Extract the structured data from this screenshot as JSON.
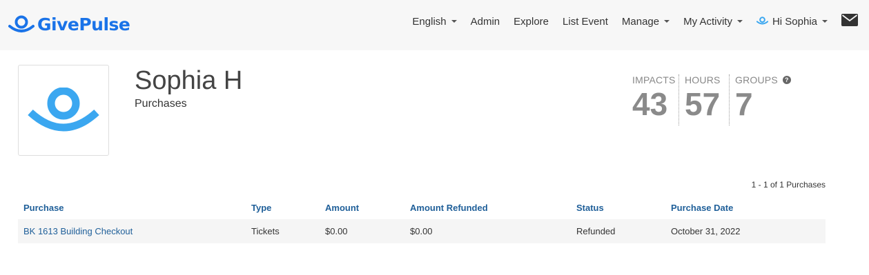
{
  "brand": {
    "name": "GivePulse",
    "color": "#1a73e8"
  },
  "nav": {
    "language": "English",
    "admin": "Admin",
    "explore": "Explore",
    "list_event": "List Event",
    "manage": "Manage",
    "my_activity": "My Activity",
    "user_greeting": "Hi Sophia",
    "icons": [
      "chevron-down-icon",
      "givepulse-logo-icon",
      "envelope-icon"
    ]
  },
  "profile": {
    "name": "Sophia H",
    "subtitle": "Purchases",
    "avatar": "givepulse-logo-icon"
  },
  "stats": {
    "impacts_label": "IMPACTS",
    "impacts_value": "43",
    "hours_label": "HOURS",
    "hours_value": "57",
    "groups_label": "GROUPS",
    "groups_value": "7",
    "help_icon": "question-circle-icon"
  },
  "purchases": {
    "count_text": "1 - 1 of 1 Purchases",
    "columns": [
      "Purchase",
      "Type",
      "Amount",
      "Amount Refunded",
      "Status",
      "Purchase Date"
    ],
    "rows": [
      {
        "purchase": "BK 1613 Building Checkout",
        "type": "Tickets",
        "amount": "$0.00",
        "amount_refunded": "$0.00",
        "status": "Refunded",
        "purchase_date": "October 31, 2022"
      }
    ]
  }
}
